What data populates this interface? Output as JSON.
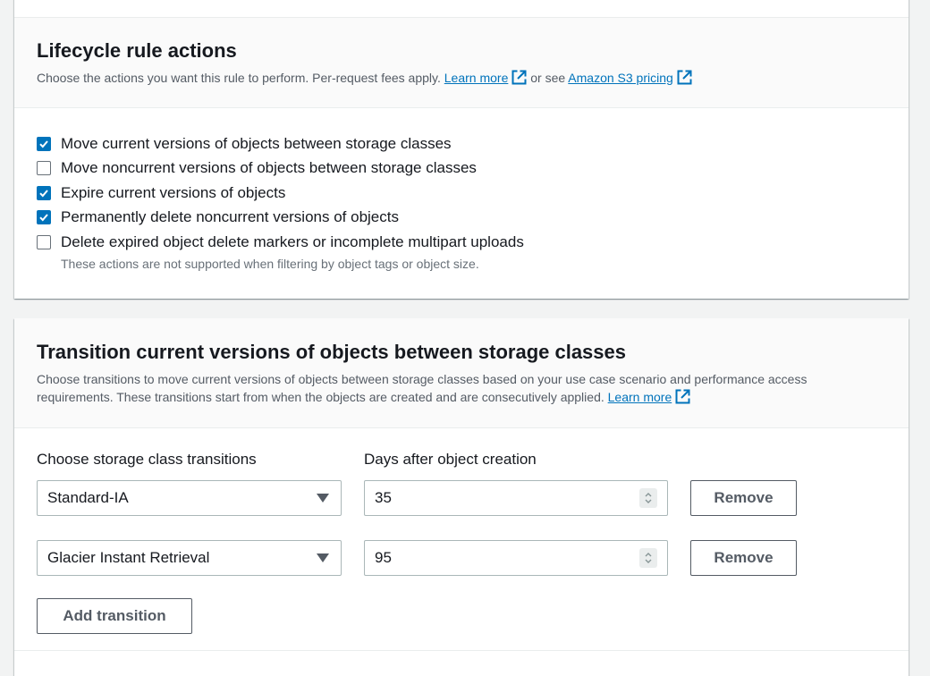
{
  "lifecycle_actions": {
    "title": "Lifecycle rule actions",
    "description": "Choose the actions you want this rule to perform. Per-request fees apply.",
    "learn_more": "Learn more",
    "or_see": "or see",
    "pricing_link": "Amazon S3 pricing",
    "options": [
      {
        "label": "Move current versions of objects between storage classes",
        "checked": true
      },
      {
        "label": "Move noncurrent versions of objects between storage classes",
        "checked": false
      },
      {
        "label": "Expire current versions of objects",
        "checked": true
      },
      {
        "label": "Permanently delete noncurrent versions of objects",
        "checked": true
      },
      {
        "label": "Delete expired object delete markers or incomplete multipart uploads",
        "checked": false
      }
    ],
    "options_hint": "These actions are not supported when filtering by object tags or object size."
  },
  "transitions": {
    "title": "Transition current versions of objects between storage classes",
    "description_line1": "Choose transitions to move current versions of objects between storage classes based on your use case scenario and performance access",
    "description_line2": "requirements. These transitions start from when the objects are created and are consecutively applied.",
    "learn_more": "Learn more",
    "storage_class_label": "Choose storage class transitions",
    "days_label": "Days after object creation",
    "rows": [
      {
        "storage_class": "Standard-IA",
        "days": "35",
        "remove_label": "Remove"
      },
      {
        "storage_class": "Glacier Instant Retrieval",
        "days": "95",
        "remove_label": "Remove"
      }
    ],
    "add_label": "Add transition"
  },
  "colors": {
    "link": "#0073bb",
    "checkbox_checked": "#0073bb",
    "text": "#16191f",
    "secondary_text": "#545b64",
    "page_background": "#f2f3f3"
  },
  "icons": {
    "external_link": "external-link-icon",
    "checkbox_check": "check-icon",
    "dropdown": "caret-down-icon",
    "number_spinner": "spinner-icon"
  }
}
